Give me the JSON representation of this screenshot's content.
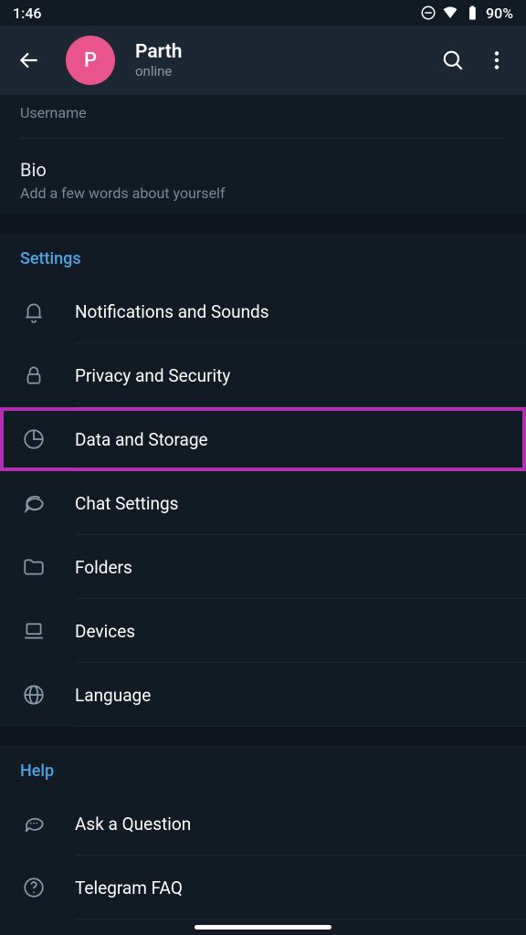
{
  "statusbar": {
    "time": "1:46",
    "battery": "90%"
  },
  "header": {
    "avatar_letter": "P",
    "name": "Parth",
    "status": "online"
  },
  "info": {
    "username_label": "Username",
    "bio_label": "Bio",
    "bio_hint": "Add a few words about yourself"
  },
  "sections": {
    "settings_title": "Settings",
    "help_title": "Help"
  },
  "settings_items": [
    {
      "label": "Notifications and Sounds",
      "icon": "bell"
    },
    {
      "label": "Privacy and Security",
      "icon": "lock"
    },
    {
      "label": "Data and Storage",
      "icon": "pie",
      "highlighted": true
    },
    {
      "label": "Chat Settings",
      "icon": "chat"
    },
    {
      "label": "Folders",
      "icon": "folder"
    },
    {
      "label": "Devices",
      "icon": "laptop"
    },
    {
      "label": "Language",
      "icon": "globe"
    }
  ],
  "help_items": [
    {
      "label": "Ask a Question",
      "icon": "chat-dots"
    },
    {
      "label": "Telegram FAQ",
      "icon": "question"
    }
  ],
  "colors": {
    "accent": "#4fa3e3",
    "avatar": "#e9548d",
    "highlight": "#b030b0",
    "bg": "#121a24",
    "header_bg": "#1c2733"
  }
}
